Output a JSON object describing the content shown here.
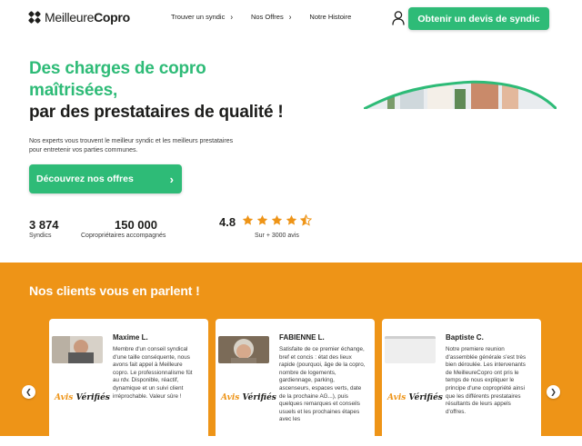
{
  "header": {
    "logo_regular": "Meilleure",
    "logo_bold": "Copro",
    "nav": [
      {
        "label": "Trouver un syndic",
        "has_chevron": true
      },
      {
        "label": "Nos Offres",
        "has_chevron": true
      },
      {
        "label": "Notre Histoire",
        "has_chevron": false
      }
    ],
    "cta_label": "Obtenir un devis de syndic"
  },
  "hero": {
    "title_line1": "Des charges de copro",
    "title_line2": "maîtrisées,",
    "title_line3": "par des prestataires de qualité !",
    "description": "Nos experts vous trouvent le meilleur syndic et les meilleurs prestataires pour entretenir vos parties communes.",
    "cta_label": "Découvrez nos offres"
  },
  "stats": {
    "syndics_value": "3 874",
    "syndics_label": "Syndics",
    "coproprietaires_value": "150 000",
    "coproprietaires_label": "Copropriétaires accompagnés",
    "rating_value": "4.8",
    "rating_stars": 4.5,
    "rating_label": "Sur + 3000 avis"
  },
  "testimonials": {
    "title": "Nos clients vous en parlent !",
    "badge_part1": "Avis",
    "badge_part2": "Vérifiés",
    "cards": [
      {
        "name": "Maxime L.",
        "text": "Membre d'un conseil syndical d'une taille conséquente, nous avons fait appel à Meilleure copro. Le professionnalisme fût au rdv. Disponible, réactif, dynamique et un suivi client irréprochable. Valeur sûre !"
      },
      {
        "name": "FABIENNE L.",
        "text": "Satisfaite de ce premier échange, bref et concis : état des lieux rapide (pourquoi, âge de la copro, nombre de logements, gardiennage, parking, ascenseurs, espaces verts, date de la prochaine AG...), puis quelques remarques et conseils usuels et les prochaines étapes avec les"
      },
      {
        "name": "Baptiste C.",
        "text": "Notre premiere reunion d'assemblée générale s'est très bien déroulée. Les intervenants de MeilleureCopro ont pris le temps de nous expliquer le principe d'une copropriété ainsi que les différents prestataires résultants de leurs appels d'offres."
      }
    ]
  },
  "colors": {
    "brand_green": "#2ebb77",
    "brand_orange": "#ee9417",
    "text_dark": "#1d1d1b"
  }
}
